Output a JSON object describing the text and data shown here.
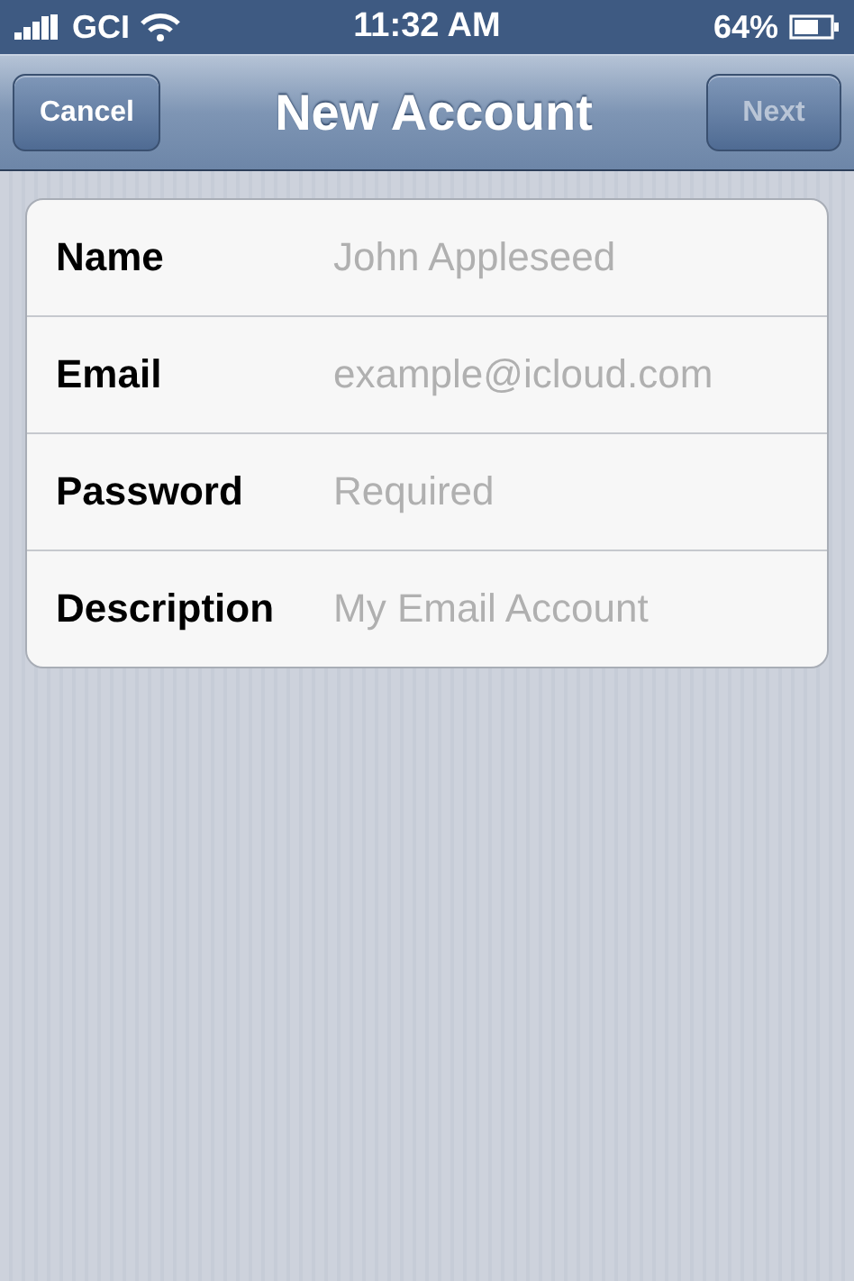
{
  "status_bar": {
    "carrier": "GCI",
    "time": "11:32 AM",
    "battery": "64%"
  },
  "nav_bar": {
    "title": "New Account",
    "left_button": {
      "label": "Cancel",
      "disabled": false
    },
    "right_button": {
      "label": "Next",
      "disabled": true
    }
  },
  "fields": [
    {
      "label": "Name",
      "placeholder": "John Appleseed"
    },
    {
      "label": "Email",
      "placeholder": "example@icloud.com"
    },
    {
      "label": "Password",
      "placeholder": "Required"
    },
    {
      "label": "Description",
      "placeholder": "My Email Account"
    }
  ]
}
